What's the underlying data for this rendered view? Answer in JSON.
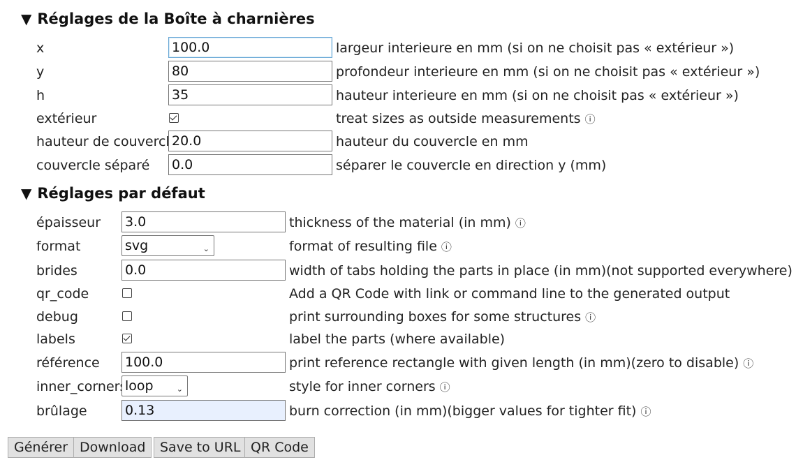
{
  "box_section": {
    "title": "Réglages de la Boîte à charnières",
    "rows": [
      {
        "label": "x",
        "value": "100.0",
        "desc": "largeur interieure en mm (si on ne choisit pas « extérieur »)"
      },
      {
        "label": "y",
        "value": "80",
        "desc": "profondeur interieure en mm (si on ne choisit pas « extérieur »)"
      },
      {
        "label": "h",
        "value": "35",
        "desc": "hauteur interieure en mm (si on ne choisit pas « extérieur »)"
      },
      {
        "label": "extérieur",
        "checked": true,
        "desc": "treat sizes as outside measurements",
        "info": "ⓘ"
      },
      {
        "label": "hauteur de couvercle",
        "value": "20.0",
        "desc": "hauteur du couvercle en mm"
      },
      {
        "label": "couvercle séparé",
        "value": "0.0",
        "desc": "séparer le couvercle en direction y (mm)"
      }
    ]
  },
  "default_section": {
    "title": "Réglages par défaut",
    "rows": [
      {
        "label": "épaisseur",
        "value": "3.0",
        "desc": "thickness of the material (in mm)",
        "info": "ⓘ"
      },
      {
        "label": "format",
        "selected": "svg",
        "desc": "format of resulting file",
        "info": "ⓘ"
      },
      {
        "label": "brides",
        "value": "0.0",
        "desc": "width of tabs holding the parts in place (in mm)(not supported everywhere)",
        "info": "ⓘ"
      },
      {
        "label": "qr_code",
        "checked": false,
        "desc": "Add a QR Code with link or command line to the generated output"
      },
      {
        "label": "debug",
        "checked": false,
        "desc": "print surrounding boxes for some structures",
        "info": "ⓘ"
      },
      {
        "label": "labels",
        "checked": true,
        "desc": "label the parts (where available)"
      },
      {
        "label": "référence",
        "value": "100.0",
        "desc": "print reference rectangle with given length (in mm)(zero to disable)",
        "info": "ⓘ"
      },
      {
        "label": "inner_corners",
        "selected": "loop",
        "desc": "style for inner corners",
        "info": "ⓘ"
      },
      {
        "label": "brûlage",
        "value": "0.13",
        "desc": "burn correction (in mm)(bigger values for tighter fit)",
        "info": "ⓘ"
      }
    ]
  },
  "buttons": {
    "generate": "Générer",
    "download": "Download",
    "save_url": "Save to URL",
    "qr_code": "QR Code"
  },
  "icons": {
    "collapse": "triangle-down-icon",
    "info": "info-icon",
    "dropdown": "chevron-down-icon"
  }
}
